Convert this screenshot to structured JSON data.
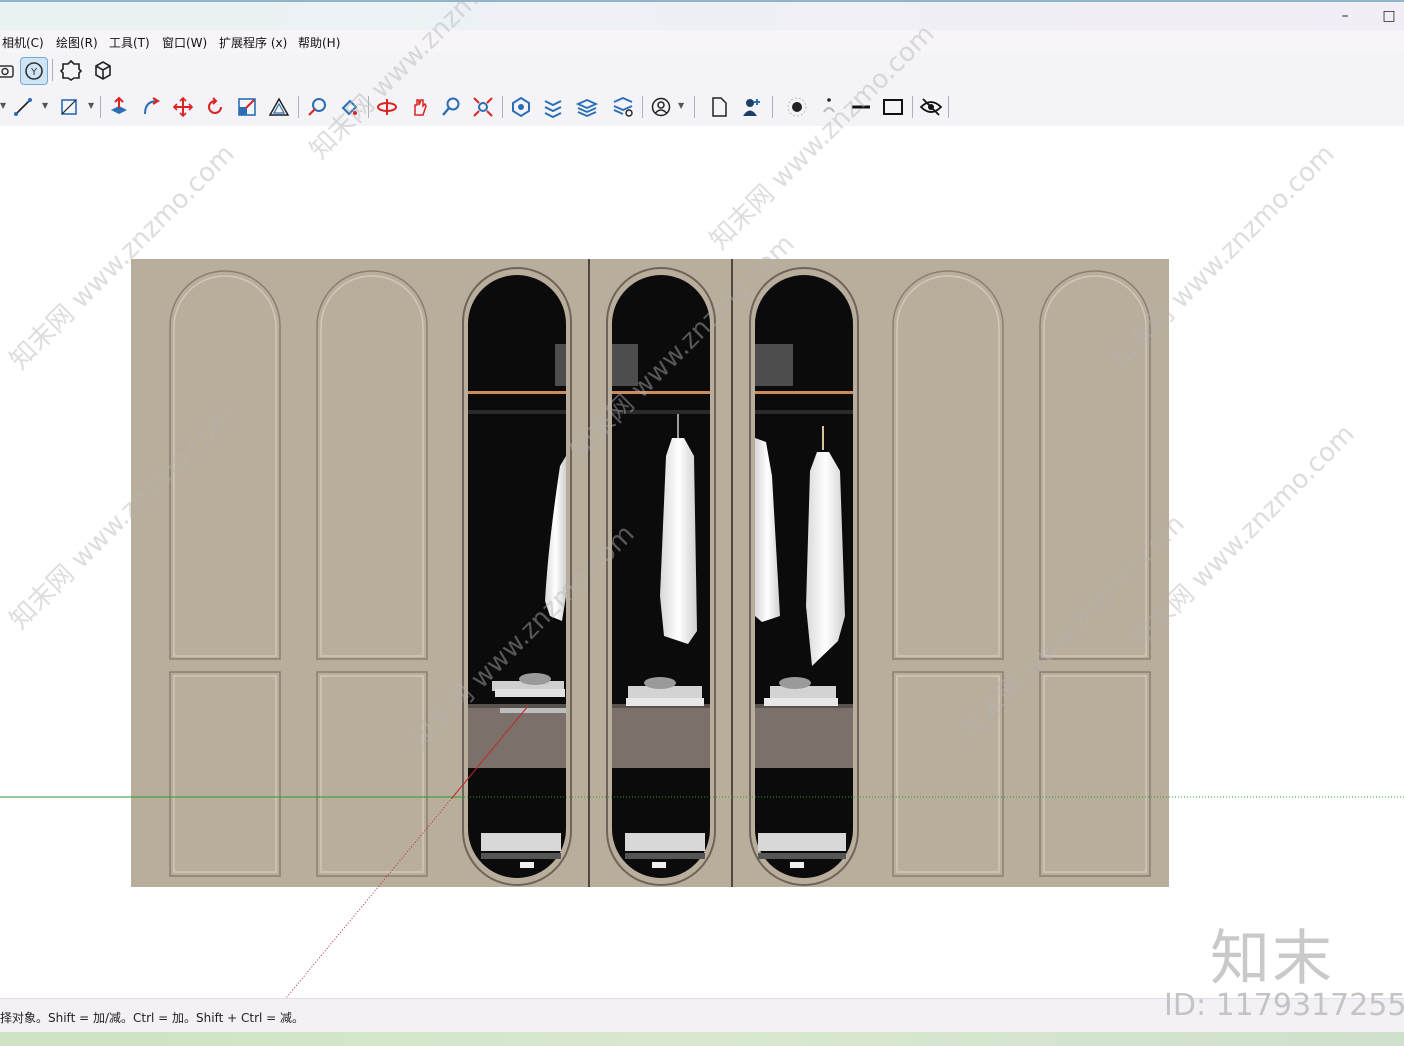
{
  "window": {
    "minimize_label": "–",
    "maximize_label": "□"
  },
  "menu": {
    "items": [
      "相机(C)",
      "绘图(R)",
      "工具(T)",
      "窗口(W)",
      "扩展程序 (x)",
      "帮助(H)"
    ]
  },
  "toolbar_top": {
    "icons": [
      "camera-icon",
      "component-browser-icon",
      "extension-warehouse-icon",
      "3d-warehouse-icon"
    ]
  },
  "toolbar_main": {
    "icons": [
      "line-tool-icon",
      "rectangle-tool-icon",
      "push-pull-icon",
      "follow-me-icon",
      "move-icon",
      "rotate-icon",
      "scale-icon",
      "offset-icon",
      "tape-measure-icon",
      "paint-bucket-icon",
      "orbit-icon",
      "pan-icon",
      "zoom-icon",
      "zoom-extents-icon",
      "geo-location-icon",
      "sandbox-icon",
      "layers-icon",
      "layer-settings-icon",
      "user-account-icon",
      "new-file-icon",
      "profile-icon",
      "shadow-icon",
      "fog-icon",
      "edge-style-icon",
      "section-fill-icon",
      "hidden-geometry-icon"
    ]
  },
  "status": {
    "text": "择对象。Shift = 加/减。Ctrl = 加。Shift + Ctrl = 减。"
  },
  "watermark": {
    "site_text": "知末网 www.znzmo.com",
    "logo_text": "知末",
    "id_text": "ID: 1179317255"
  },
  "colors": {
    "panel": "#b9ad9c",
    "interior": "#0b0b0b",
    "green_axis": "#2f9a2f",
    "red_axis": "#c0282c",
    "shelf": "#cf8a5a"
  }
}
